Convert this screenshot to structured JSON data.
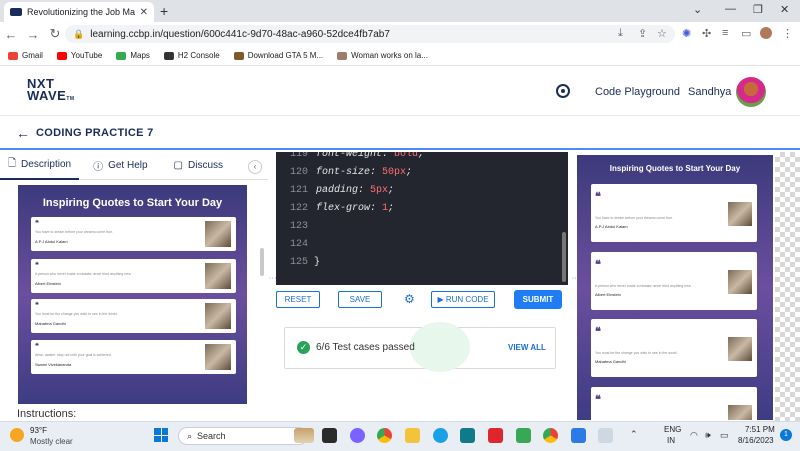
{
  "browser": {
    "tab_title": "Revolutionizing the Job Market | N",
    "url": "learning.ccbp.in/question/600c441c-9d70-48ac-a960-52dce4fb7ab7",
    "bookmarks": [
      "Gmail",
      "YouTube",
      "Maps",
      "H2 Console",
      "Download GTA 5 M...",
      "Woman works on la..."
    ]
  },
  "header": {
    "logo_line1": "NXT",
    "logo_line2": "WAVE",
    "logo_tm": "TM",
    "playground_label": "Code Playground",
    "user_name": "Sandhya"
  },
  "practice": {
    "title": "CODING PRACTICE 7"
  },
  "left_tabs": {
    "description": "Description",
    "get_help": "Get Help",
    "discuss": "Discuss"
  },
  "preview": {
    "title": "Inspiring Quotes to Start Your Day",
    "quotes": [
      {
        "text": "You have to dream before your dreams come true.",
        "author": "A.P.J Abdul Kalam"
      },
      {
        "text": "A person who never made a mistake never tried anything new.",
        "author": "Albert Einstein"
      },
      {
        "text": "You must be the change you wish to see in the world.",
        "author": "Mahatma Gandhi"
      },
      {
        "text": "Arise, awake, stop not until your goal is achieved.",
        "author": "Swami Vivekananda"
      }
    ]
  },
  "instructions_label": "Instructions:",
  "editor": {
    "lines": [
      {
        "num": "119",
        "prop": "font-weight",
        "value": "bold"
      },
      {
        "num": "120",
        "prop": "font-size",
        "value": "50px"
      },
      {
        "num": "121",
        "prop": "padding",
        "value": "5px"
      },
      {
        "num": "122",
        "prop": "flex-grow",
        "value": "1"
      },
      {
        "num": "123",
        "prop": "",
        "value": ""
      },
      {
        "num": "124",
        "prop": "",
        "value": ""
      },
      {
        "num": "125",
        "prop": "}",
        "value": ""
      }
    ]
  },
  "actions": {
    "reset": "RESET",
    "save": "SAVE",
    "run": "RUN CODE",
    "submit": "SUBMIT"
  },
  "results": {
    "summary": "6/6 Test cases passed",
    "view_all": "VIEW ALL"
  },
  "taskbar": {
    "temperature": "93°F",
    "condition": "Mostly clear",
    "search_placeholder": "Search",
    "lang_line1": "ENG",
    "lang_line2": "IN",
    "time": "7:51 PM",
    "date": "8/16/2023",
    "notifications": "1"
  }
}
